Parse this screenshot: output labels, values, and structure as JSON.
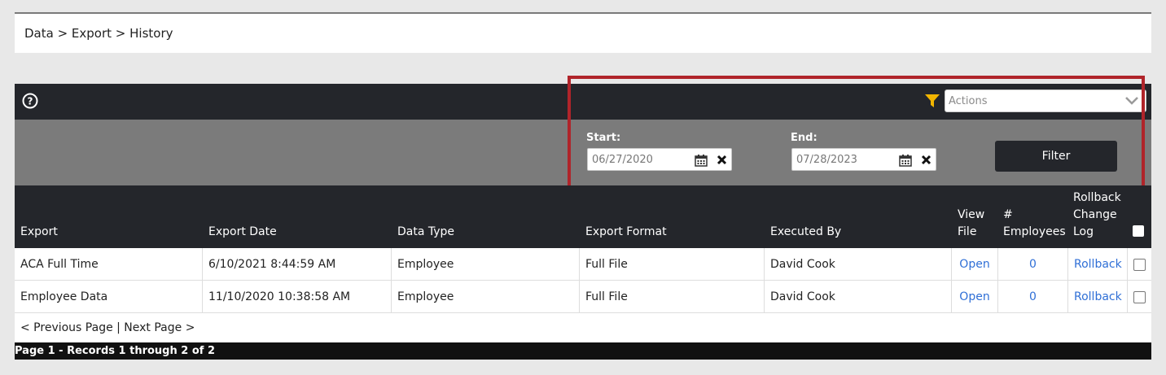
{
  "breadcrumb": "Data > Export > History",
  "toolbar": {
    "actions_placeholder": "Actions"
  },
  "filter": {
    "start_label": "Start:",
    "start_value": "06/27/2020",
    "end_label": "End:",
    "end_value": "07/28/2023",
    "button_label": "Filter"
  },
  "table": {
    "headers": {
      "export": "Export",
      "export_date": "Export Date",
      "data_type": "Data Type",
      "export_format": "Export Format",
      "executed_by": "Executed By",
      "view_file_1": "View",
      "view_file_2": "File",
      "employees_1": "#",
      "employees_2": "Employees",
      "rollback_1": "Rollback",
      "rollback_2": "Change",
      "rollback_3": "Log"
    },
    "rows": [
      {
        "export": "ACA Full Time",
        "export_date": "6/10/2021 8:44:59 AM",
        "data_type": "Employee",
        "export_format": "Full File",
        "executed_by": "David Cook",
        "view_file": "Open",
        "employees": "0",
        "rollback": "Rollback"
      },
      {
        "export": "Employee Data",
        "export_date": "11/10/2020 10:38:58 AM",
        "data_type": "Employee",
        "export_format": "Full File",
        "executed_by": "David Cook",
        "view_file": "Open",
        "employees": "0",
        "rollback": "Rollback"
      }
    ]
  },
  "pager": "< Previous Page | Next Page >",
  "footer": "Page 1 - Records 1 through 2 of 2",
  "colors": {
    "dark": "#24262b",
    "band": "#7b7b7b",
    "highlight": "#b0242a",
    "link": "#2f6fd6",
    "funnel": "#f2b500"
  }
}
